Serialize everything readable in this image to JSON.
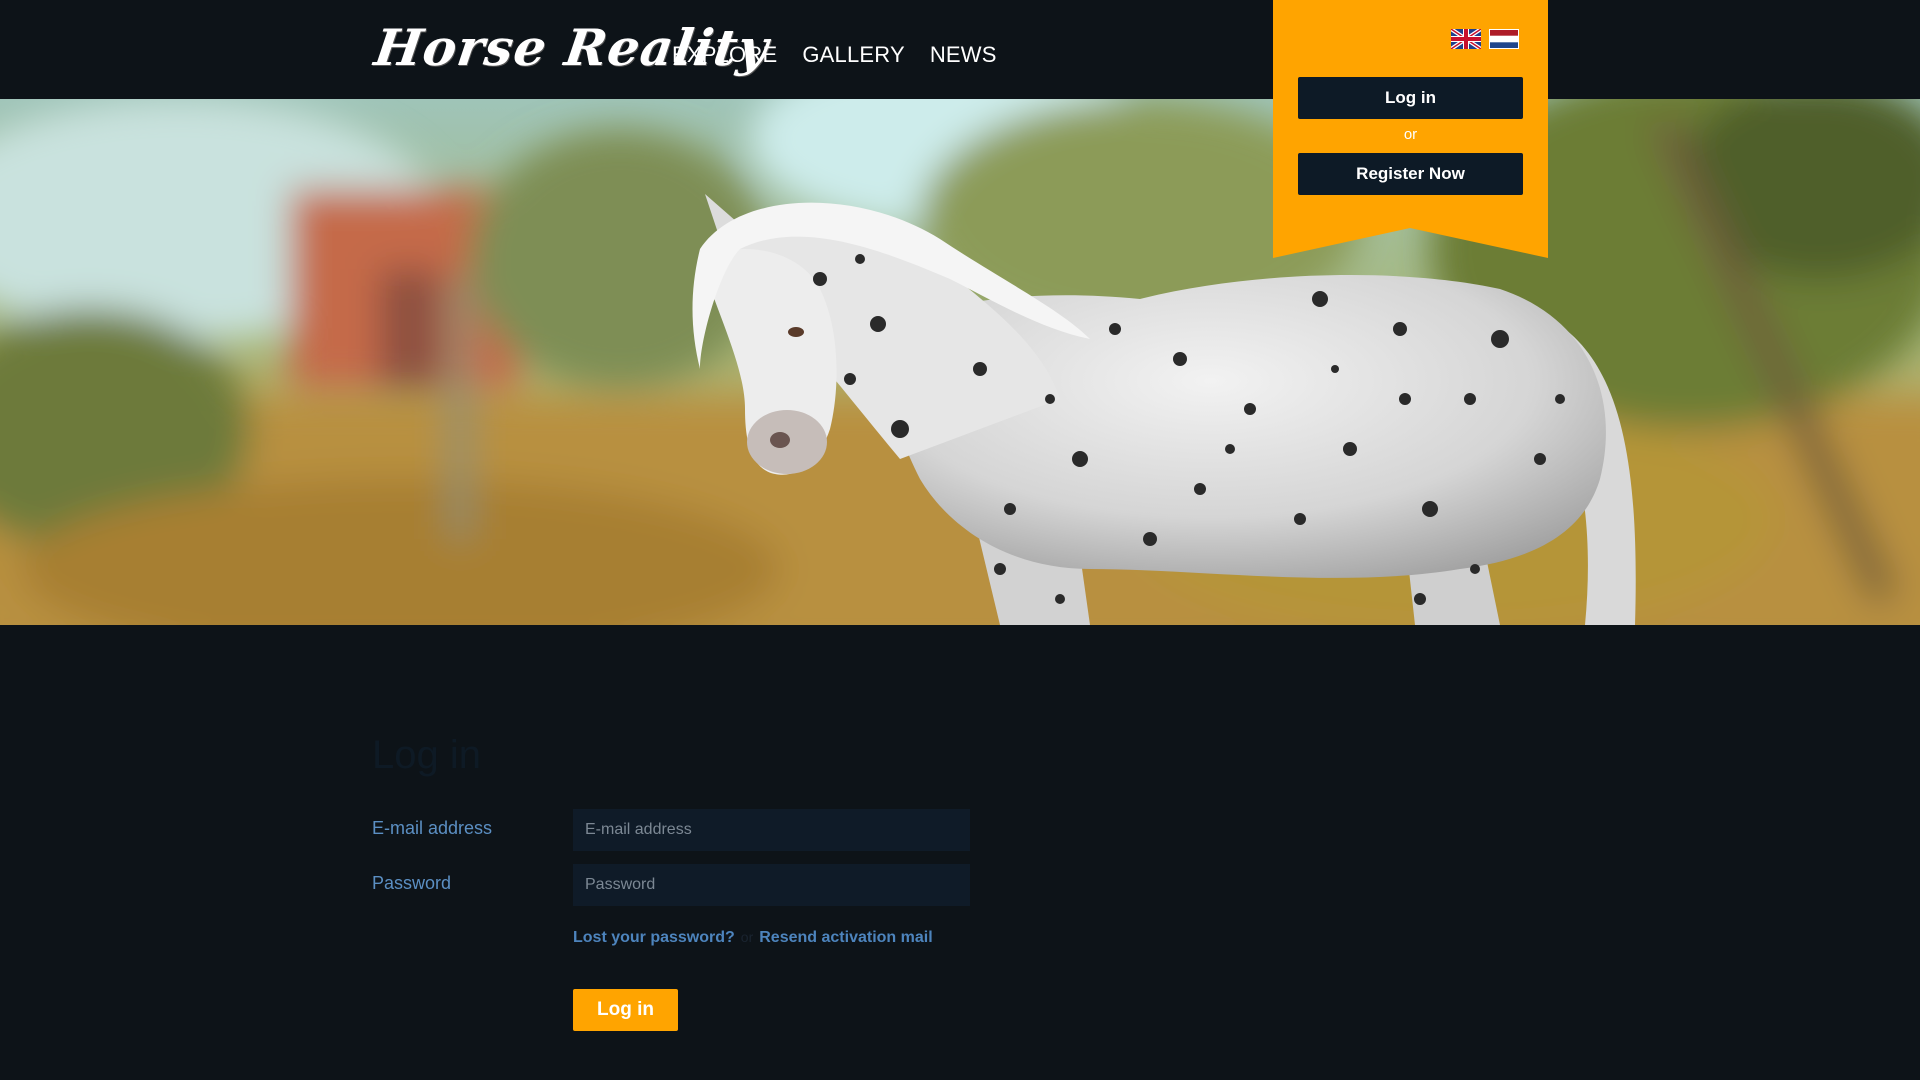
{
  "header": {
    "logo_text": "Horse Reality",
    "nav": [
      {
        "label": "EXPLORE"
      },
      {
        "label": "GALLERY"
      },
      {
        "label": "NEWS"
      }
    ]
  },
  "ribbon": {
    "flags": [
      "uk-flag-icon",
      "netherlands-flag-icon"
    ],
    "login_label": "Log in",
    "or_text": "or",
    "register_label": "Register Now"
  },
  "login_form": {
    "title": "Log in",
    "email_label": "E-mail address",
    "email_placeholder": "E-mail address",
    "email_value": "",
    "password_label": "Password",
    "password_placeholder": "Password",
    "password_value": "",
    "lost_password_link": "Lost your password?",
    "separator": "or",
    "resend_link": "Resend activation mail",
    "submit_label": "Log in"
  },
  "colors": {
    "background": "#0d1318",
    "accent_orange": "#ffa400",
    "dark_button": "#0d1a26",
    "label_blue": "#5b8fc3",
    "link_blue": "#4d84bd",
    "input_bg": "#0f1b28"
  }
}
